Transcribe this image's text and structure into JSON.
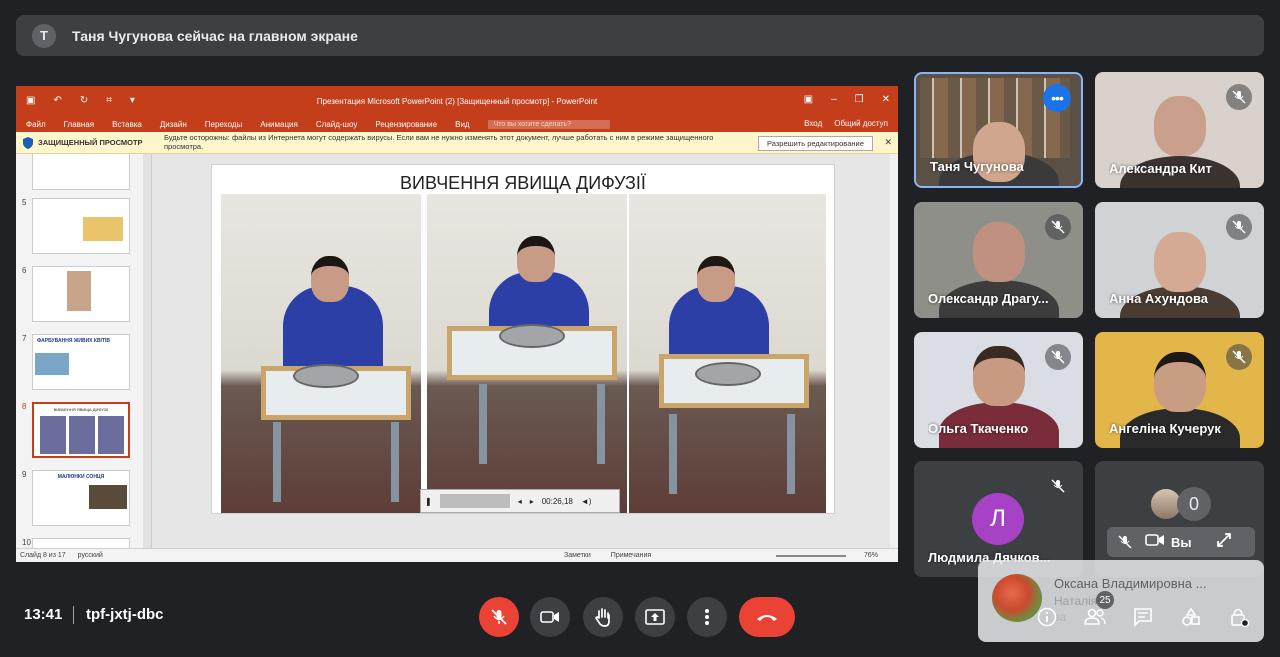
{
  "banner": {
    "avatar_letter": "T",
    "text": "Таня Чугунова сейчас на главном экране"
  },
  "ppt": {
    "title": "Презентация Microsoft PowerPoint (2) [Защищенный просмотр] - PowerPoint",
    "tabs": [
      "Файл",
      "Главная",
      "Вставка",
      "Дизайн",
      "Переходы",
      "Анимация",
      "Слайд-шоу",
      "Рецензирование",
      "Вид"
    ],
    "tell_me": "Что вы хотите сделать?",
    "login": "Вход",
    "share": "Общий доступ",
    "protected_label": "ЗАЩИЩЕННЫЙ ПРОСМОТР",
    "protected_msg": "Будьте осторожны: файлы из Интернета могут содержать вирусы. Если вам не нужно изменять этот документ, лучше работать с ним в режиме защищенного просмотра.",
    "enable_edit": "Разрешить редактирование",
    "thumb_numbers": [
      "5",
      "6",
      "7",
      "8",
      "9",
      "10"
    ],
    "thumb_titles": [
      "",
      "",
      "ФАРБУВАННЯ ЖИВИХ КВІТІВ",
      "ВИВЧЕННЯ ЯВИЩА ДИФУЗІЇ",
      "МАЛЮНКИ СОНЦЯ",
      ""
    ],
    "slide_title": "ВИВЧЕННЯ ЯВИЩА ДИФУЗІЇ",
    "media_time": "00:26,18",
    "status_slide": "Слайд 8 из 17",
    "status_lang": "русский",
    "status_notes": "Заметки",
    "status_comments": "Примечания",
    "zoom": "76%"
  },
  "participants": [
    {
      "name": "Таня Чугунова",
      "muted": false,
      "active": true
    },
    {
      "name": "Александра Кит",
      "muted": true
    },
    {
      "name": "Олександр Драгу...",
      "muted": true
    },
    {
      "name": "Анна Ахундова",
      "muted": true
    },
    {
      "name": "Ольга Ткаченко",
      "muted": true
    },
    {
      "name": "Ангеліна Кучерук",
      "muted": true
    },
    {
      "name": "Людмила Дячков...",
      "muted": true,
      "initial": "Л"
    }
  ],
  "self": {
    "hidden_count": "0",
    "label": "Вы"
  },
  "notification": {
    "name": "Оксана Владимировна ...",
    "line1": "Наталія",
    "line2": "за"
  },
  "meeting": {
    "time": "13:41",
    "code": "tpf-jxtj-dbc",
    "people_count": "25"
  },
  "colors": {
    "meet_bg": "#202124",
    "tile_bg": "#3c4043",
    "red": "#ea4335",
    "blue": "#1a73e8",
    "ppt_orange": "#c43e1c"
  }
}
